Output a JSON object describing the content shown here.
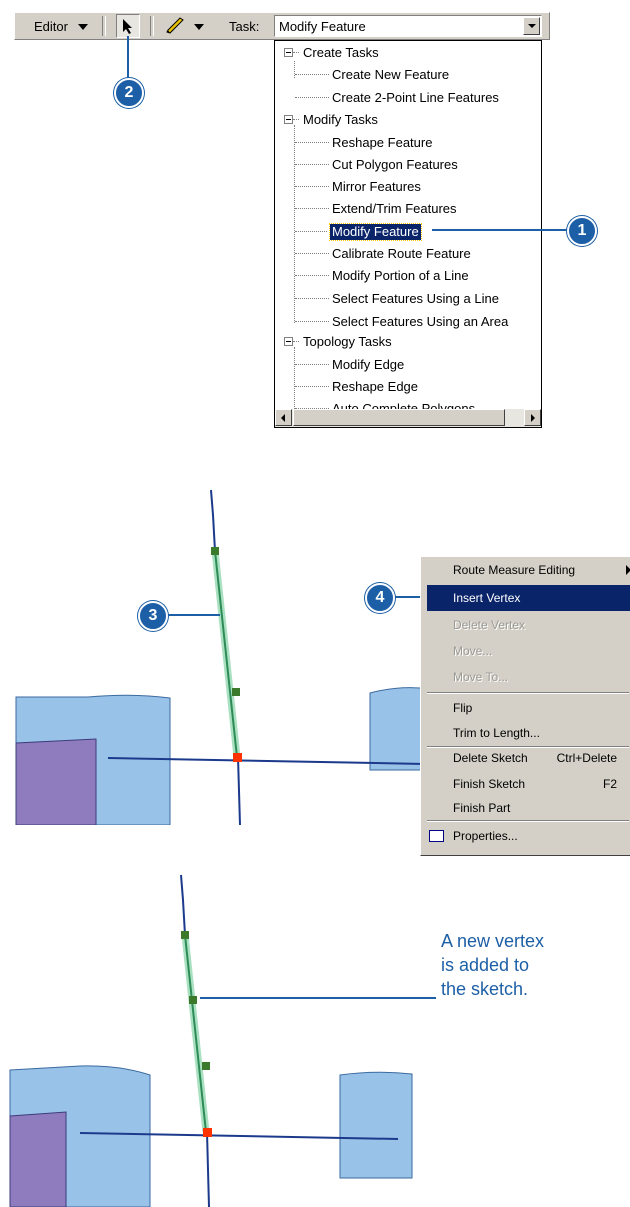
{
  "toolbar": {
    "editor_label": "Editor",
    "task_label": "Task:",
    "task_value": "Modify Feature"
  },
  "task_list": {
    "groups": [
      {
        "label": "Create Tasks",
        "items": [
          "Create New Feature",
          "Create 2-Point Line Features"
        ]
      },
      {
        "label": "Modify Tasks",
        "items": [
          "Reshape Feature",
          "Cut Polygon Features",
          "Mirror Features",
          "Extend/Trim Features",
          "Modify Feature",
          "Calibrate Route Feature",
          "Modify Portion of a Line",
          "Select Features Using a Line",
          "Select Features Using an Area"
        ]
      },
      {
        "label": "Topology Tasks",
        "items": [
          "Modify Edge",
          "Reshape Edge",
          "Auto Complete Polygons"
        ]
      }
    ],
    "selected": "Modify Feature"
  },
  "callouts": [
    "1",
    "2",
    "3",
    "4"
  ],
  "context_menu": {
    "items": [
      {
        "label": "Route Measure Editing",
        "shortcut": "",
        "enabled": true,
        "submenu": true
      },
      {
        "label": "Insert Vertex",
        "shortcut": "",
        "enabled": true,
        "highlighted": true
      },
      {
        "label": "Delete Vertex",
        "shortcut": "",
        "enabled": false
      },
      {
        "label": "Move...",
        "shortcut": "",
        "enabled": false
      },
      {
        "label": "Move To...",
        "shortcut": "",
        "enabled": false
      },
      {
        "label": "Flip",
        "shortcut": "",
        "enabled": true
      },
      {
        "label": "Trim to Length...",
        "shortcut": "",
        "enabled": true
      },
      {
        "label": "Delete Sketch",
        "shortcut": "Ctrl+Delete",
        "enabled": true
      },
      {
        "label": "Finish Sketch",
        "shortcut": "F2",
        "enabled": true
      },
      {
        "label": "Finish Part",
        "shortcut": "",
        "enabled": true
      },
      {
        "label": "Properties...",
        "shortcut": "",
        "enabled": true,
        "icon": "properties-icon"
      }
    ]
  },
  "annotation": {
    "line1": "A new vertex",
    "line2": "is added to",
    "line3": "the sketch."
  },
  "colors": {
    "callout": "#1d5fa6",
    "polygon_blue": "#99c2e8",
    "polygon_purple": "#8e7cbf",
    "sketch_line": "#2e8b57",
    "sketch_halo": "#a8e0c0",
    "vertex": "#3a7a2a",
    "last_vertex": "#ff3300",
    "map_line": "#1c3a8c",
    "menu_highlight": "#0a246a"
  }
}
